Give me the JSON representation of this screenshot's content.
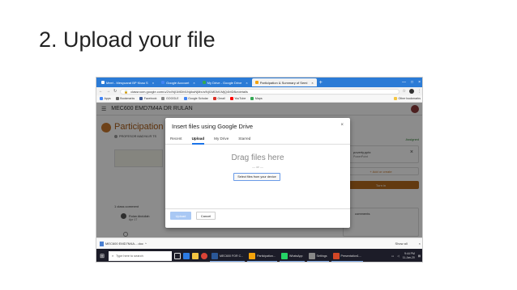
{
  "slide": {
    "title": "2. Upload your file"
  },
  "browser": {
    "tabs": [
      {
        "label": "Meet - Mesyuarat BP Kbau S",
        "color": "#ffffff",
        "active": false
      },
      {
        "label": "Google Account",
        "color": "#4285f4",
        "active": false
      },
      {
        "label": "My Drive - Google Drive",
        "color": "#34a853",
        "active": false
      },
      {
        "label": "Participation & Summary of Semi",
        "color": "#f4a30b",
        "active": true
      }
    ],
    "new_tab": "+",
    "url": "classroom.google.com/u/2/c/NjI1MDM1NjAwNjMx/a/NjI1MDM1MjQ4MDBz/details",
    "bookmarks": [
      {
        "label": "Apps",
        "color": "#4285f4"
      },
      {
        "label": "Bookmarks",
        "color": "#666666"
      },
      {
        "label": "Facebook",
        "color": "#3b5998"
      },
      {
        "label": "GOOGLE",
        "color": "#888888"
      },
      {
        "label": "Google Scholar",
        "color": "#4285f4"
      },
      {
        "label": "Gmail",
        "color": "#d93025"
      },
      {
        "label": "YouTube",
        "color": "#ff0000"
      },
      {
        "label": "Maps",
        "color": "#34a853"
      }
    ],
    "other_bookmarks": "Other bookmarks"
  },
  "classroom": {
    "course": "MEC600 EMD7M4A DR RULAN",
    "assignment_title": "Participation",
    "teacher": "PROFESOR MADYA IR TS",
    "attachment_name": "5.0 ME",
    "attachment_type": "PDF",
    "class_comments": "1 class comment",
    "commenter": "Rulan Abdullah",
    "comment_date": "Apr 17",
    "status": "Assigned",
    "file_name": "poverty.pptx",
    "file_type": "PowerPoint",
    "add_create": "+ Add or create",
    "turn_in": "Turn in",
    "private_comments": "comments"
  },
  "dialog": {
    "title": "Insert files using Google Drive",
    "close": "×",
    "tabs": [
      {
        "label": "Recent",
        "active": false
      },
      {
        "label": "Upload",
        "active": true
      },
      {
        "label": "My Drive",
        "active": false
      },
      {
        "label": "Starred",
        "active": false
      }
    ],
    "drag_text": "Drag files here",
    "or_text": "— or —",
    "select_button": "Select files from your device",
    "upload_button": "Upload",
    "cancel_button": "Cancel"
  },
  "downloads": {
    "file": "MEC600 EMD7M4A....doc",
    "show_all": "Show all",
    "close": "×"
  },
  "taskbar": {
    "search_placeholder": "Type here to search",
    "apps": [
      {
        "label": "MEC600 FOR C...",
        "color": "#2b5797"
      },
      {
        "label": "Participation...",
        "color": "#f4a30b"
      },
      {
        "label": "WhatsApp",
        "color": "#25d366"
      },
      {
        "label": "Settings",
        "color": "#888888"
      },
      {
        "label": "Presentation1...",
        "color": "#d24726"
      }
    ],
    "time": "9:44 PM",
    "date": "11-Jan-20"
  }
}
